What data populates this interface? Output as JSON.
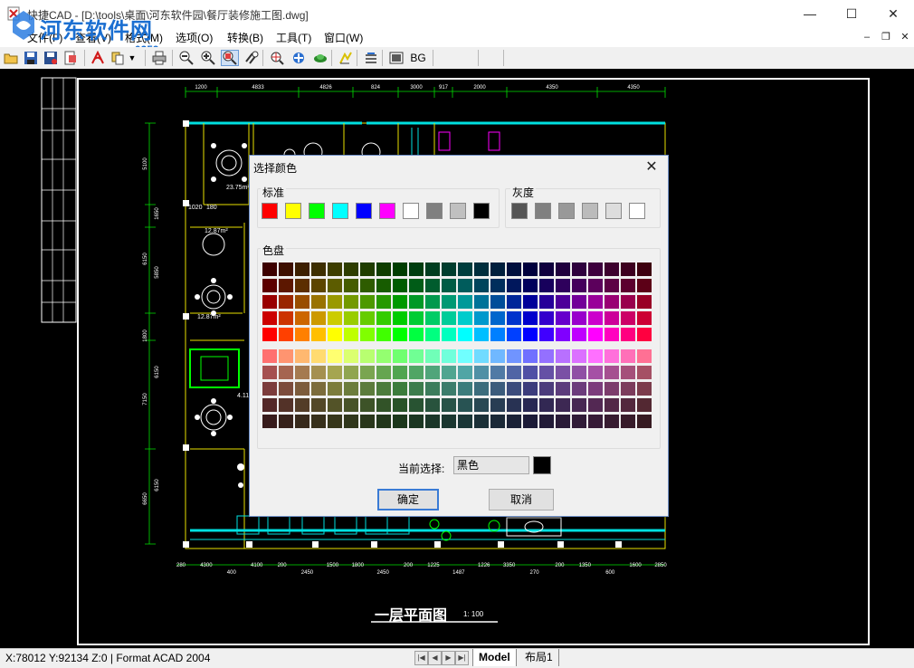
{
  "window": {
    "title": "快捷CAD - [D:\\tools\\桌面\\河东软件园\\餐厅装修施工图.dwg]",
    "minimize_glyph": "—",
    "maximize_glyph": "☐",
    "close_glyph": "✕"
  },
  "watermark": {
    "title": "河东软件网",
    "url": "www.pc0359.cn"
  },
  "menu": {
    "items": [
      "文件(F)",
      "查看(V)",
      "格式(M)",
      "选项(O)",
      "转换(B)",
      "工具(T)",
      "窗口(W)"
    ],
    "mdi_minimize": "–",
    "mdi_restore": "❐",
    "mdi_close": "✕"
  },
  "toolbar": {
    "icons": [
      "open-folder-icon",
      "save-icon",
      "save-as-icon",
      "print-preview-icon",
      "acrobat-icon",
      "copy-icon",
      "print-icon",
      "zoom-out-icon",
      "zoom-in-icon",
      "zoom-window-icon",
      "zoom-realtime-icon",
      "zoom-extents-icon",
      "pan-icon",
      "regen-icon",
      "layers-icon",
      "properties-icon"
    ],
    "bg_label": "BG"
  },
  "drawing": {
    "top_dims": [
      "1200",
      "4833",
      "4826",
      "824",
      "3000",
      "917",
      "2000",
      "4350",
      "4350"
    ],
    "left_dims": [
      "5100",
      "1650",
      "6150",
      "5850",
      "1800",
      "6150",
      "7150",
      "6150",
      "6650"
    ],
    "bottom_dims": [
      "280",
      "4300",
      "400",
      "4100",
      "200",
      "2450",
      "1500",
      "1800",
      "2450",
      "200",
      "1225",
      "1487",
      "1226",
      "3350",
      "270",
      "200",
      "1350",
      "600",
      "1600",
      "2850"
    ],
    "room_labels": [
      "23.75m²",
      "12.87m²",
      "12.87m²",
      "4.11",
      "1020",
      "180"
    ],
    "plan_title": "一层平面图",
    "plan_scale": "1: 100"
  },
  "dialog": {
    "title": "选择颜色",
    "close_glyph": "✕",
    "standard_label": "标准",
    "standard_colors": [
      "#ff0000",
      "#ffff00",
      "#00ff00",
      "#00ffff",
      "#0000ff",
      "#ff00ff",
      "#ffffff",
      "#808080",
      "#c0c0c0",
      "#000000"
    ],
    "gray_label": "灰度",
    "gray_colors": [
      "#555555",
      "#808080",
      "#999999",
      "#bbbbbb",
      "#dddddd",
      "#ffffff"
    ],
    "palette_label": "色盘",
    "current_label": "当前选择:",
    "current_value": "黑色",
    "current_color": "#000000",
    "ok_label": "确定",
    "cancel_label": "取消"
  },
  "status": {
    "text": "X:78012 Y:92134 Z:0 | Format ACAD 2004",
    "nav": [
      "|◀",
      "◀",
      "▶",
      "▶|"
    ],
    "tabs": [
      "Model",
      "布局1"
    ]
  }
}
